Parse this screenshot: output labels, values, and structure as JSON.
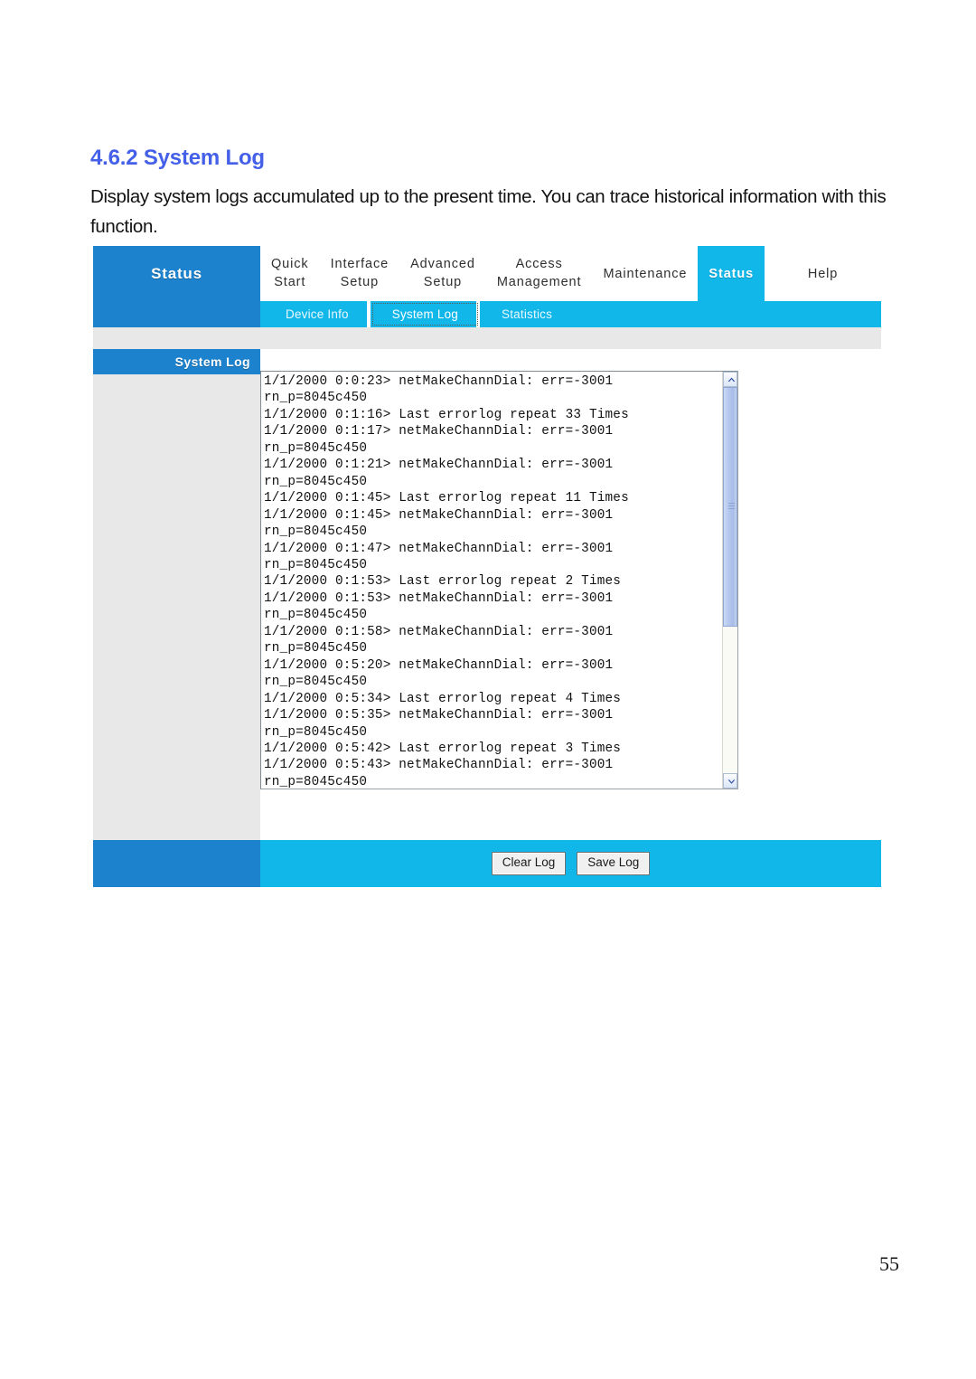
{
  "document": {
    "section_number": "4.6.2",
    "section_title": "System Log",
    "heading_full": "4.6.2 System Log",
    "paragraph": "Display system logs accumulated up to the present time. You can trace historical information with this function.",
    "page_number": "55"
  },
  "ui": {
    "brand_label": "Status",
    "nav_tabs": [
      {
        "label": "Quick Start",
        "line1": "Quick",
        "line2": "Start",
        "active": false
      },
      {
        "label": "Interface Setup",
        "line1": "Interface",
        "line2": "Setup",
        "active": false
      },
      {
        "label": "Advanced Setup",
        "line1": "Advanced",
        "line2": "Setup",
        "active": false
      },
      {
        "label": "Access Management",
        "line1": "Access",
        "line2": "Management",
        "active": false
      },
      {
        "label": "Maintenance",
        "line1": "Maintenance",
        "line2": "",
        "active": false
      },
      {
        "label": "Status",
        "line1": "Status",
        "line2": "",
        "active": true
      },
      {
        "label": "Help",
        "line1": "Help",
        "line2": "",
        "active": false
      }
    ],
    "sub_tabs": [
      {
        "label": "Device Info",
        "selected": false
      },
      {
        "label": "System Log",
        "selected": true
      },
      {
        "label": "Statistics",
        "selected": false
      }
    ],
    "sidebar": {
      "header_label": "System Log"
    },
    "log": {
      "content": "1/1/2000 0:0:23> netMakeChannDial: err=-3001\nrn_p=8045c450\n1/1/2000 0:1:16> Last errorlog repeat 33 Times\n1/1/2000 0:1:17> netMakeChannDial: err=-3001\nrn_p=8045c450\n1/1/2000 0:1:21> netMakeChannDial: err=-3001\nrn_p=8045c450\n1/1/2000 0:1:45> Last errorlog repeat 11 Times\n1/1/2000 0:1:45> netMakeChannDial: err=-3001\nrn_p=8045c450\n1/1/2000 0:1:47> netMakeChannDial: err=-3001\nrn_p=8045c450\n1/1/2000 0:1:53> Last errorlog repeat 2 Times\n1/1/2000 0:1:53> netMakeChannDial: err=-3001\nrn_p=8045c450\n1/1/2000 0:1:58> netMakeChannDial: err=-3001\nrn_p=8045c450\n1/1/2000 0:5:20> netMakeChannDial: err=-3001\nrn_p=8045c450\n1/1/2000 0:5:34> Last errorlog repeat 4 Times\n1/1/2000 0:5:35> netMakeChannDial: err=-3001\nrn_p=8045c450\n1/1/2000 0:5:42> Last errorlog repeat 3 Times\n1/1/2000 0:5:43> netMakeChannDial: err=-3001\nrn_p=8045c450",
      "lines": [
        "1/1/2000 0:0:23> netMakeChannDial: err=-3001",
        "rn_p=8045c450",
        "1/1/2000 0:1:16> Last errorlog repeat 33 Times",
        "1/1/2000 0:1:17> netMakeChannDial: err=-3001",
        "rn_p=8045c450",
        "1/1/2000 0:1:21> netMakeChannDial: err=-3001",
        "rn_p=8045c450",
        "1/1/2000 0:1:45> Last errorlog repeat 11 Times",
        "1/1/2000 0:1:45> netMakeChannDial: err=-3001",
        "rn_p=8045c450",
        "1/1/2000 0:1:47> netMakeChannDial: err=-3001",
        "rn_p=8045c450",
        "1/1/2000 0:1:53> Last errorlog repeat 2 Times",
        "1/1/2000 0:1:53> netMakeChannDial: err=-3001",
        "rn_p=8045c450",
        "1/1/2000 0:1:58> netMakeChannDial: err=-3001",
        "rn_p=8045c450",
        "1/1/2000 0:5:20> netMakeChannDial: err=-3001",
        "rn_p=8045c450",
        "1/1/2000 0:5:34> Last errorlog repeat 4 Times",
        "1/1/2000 0:5:35> netMakeChannDial: err=-3001",
        "rn_p=8045c450",
        "1/1/2000 0:5:42> Last errorlog repeat 3 Times",
        "1/1/2000 0:5:43> netMakeChannDial: err=-3001",
        "rn_p=8045c450"
      ],
      "scroll_thumb_percent": 62
    },
    "buttons": {
      "clear_log": "Clear Log",
      "save_log": "Save Log"
    },
    "colors": {
      "brand_blue": "#1d82cd",
      "accent_cyan": "#12b7ea",
      "gray_band": "#e8e8e8",
      "heading_blue": "#4460e8"
    }
  }
}
